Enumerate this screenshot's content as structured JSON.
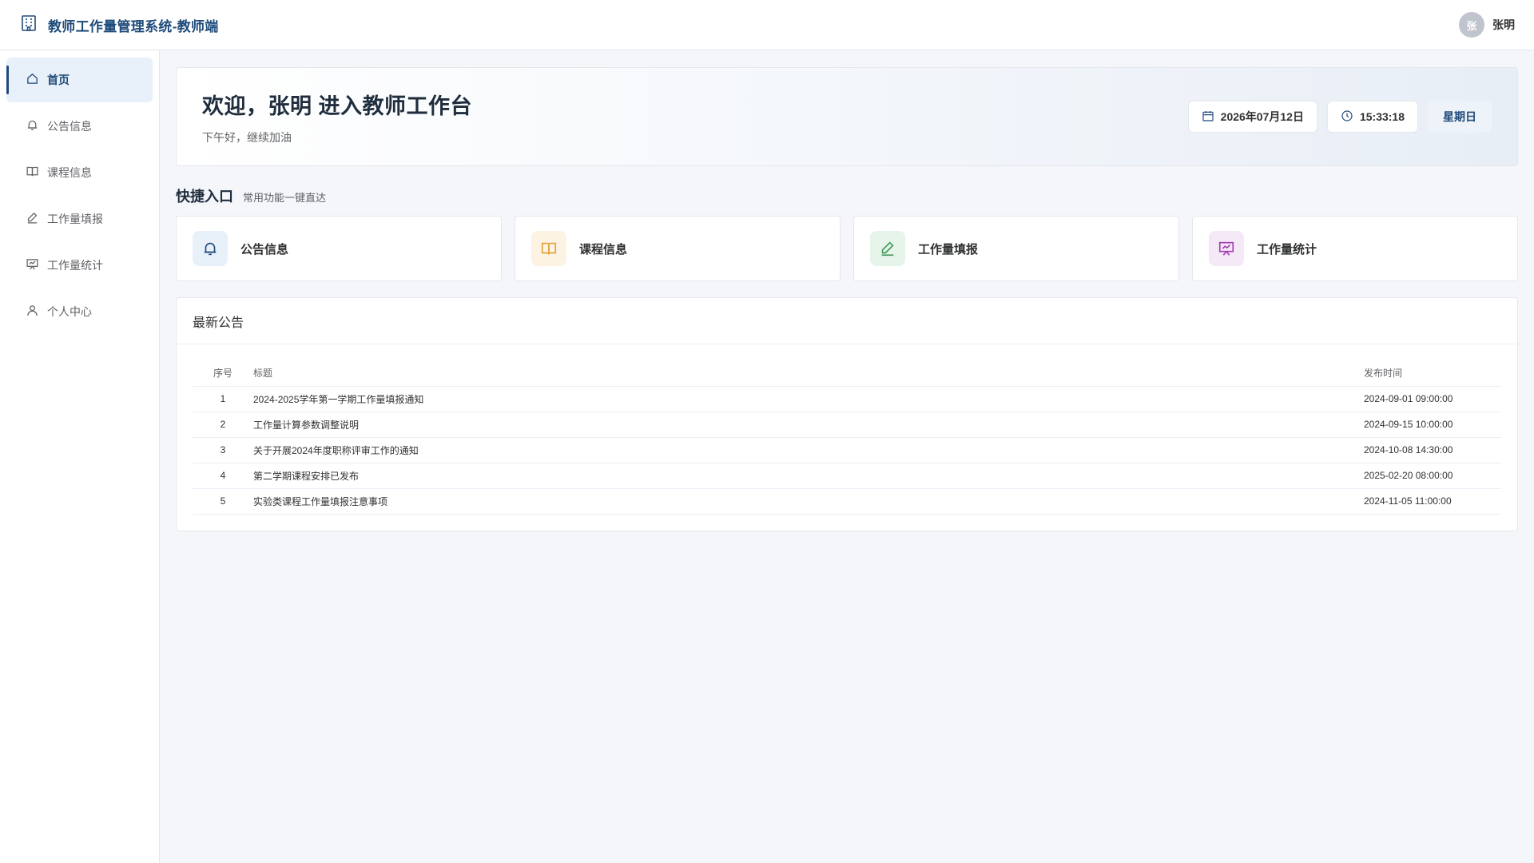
{
  "header": {
    "title": "教师工作量管理系统-教师端",
    "avatar_text": "张",
    "user_name": "张明"
  },
  "sidebar": {
    "items": [
      {
        "label": "首页",
        "icon": "home-icon",
        "active": true
      },
      {
        "label": "公告信息",
        "icon": "bell-icon"
      },
      {
        "label": "课程信息",
        "icon": "book-icon"
      },
      {
        "label": "工作量填报",
        "icon": "edit-pen-icon"
      },
      {
        "label": "工作量统计",
        "icon": "presentation-chart-icon"
      },
      {
        "label": "个人中心",
        "icon": "user-icon"
      }
    ]
  },
  "welcome": {
    "title": "欢迎，张明 进入教师工作台",
    "subtitle": "下午好，继续加油",
    "date": "2026年07月12日",
    "time": "15:33:18",
    "weekday": "星期日"
  },
  "quick": {
    "title": "快捷入口",
    "subtitle": "常用功能一键直达",
    "items": [
      {
        "label": "公告信息",
        "icon": "bell-icon",
        "color": "#1f4b7a",
        "bg": "#e8f0f9"
      },
      {
        "label": "课程信息",
        "icon": "book-icon",
        "color": "#e6a23c",
        "bg": "#fdf3e3"
      },
      {
        "label": "工作量填报",
        "icon": "edit-pen-icon",
        "color": "#3f9a5a",
        "bg": "#e6f4ea"
      },
      {
        "label": "工作量统计",
        "icon": "presentation-chart-icon",
        "color": "#a23fb0",
        "bg": "#f5e8f7"
      }
    ]
  },
  "notices": {
    "title": "最新公告",
    "columns": {
      "index": "序号",
      "title": "标题",
      "time": "发布时间"
    },
    "rows": [
      {
        "index": "1",
        "title": "2024-2025学年第一学期工作量填报通知",
        "time": "2024-09-01 09:00:00"
      },
      {
        "index": "2",
        "title": "工作量计算参数调整说明",
        "time": "2024-09-15 10:00:00"
      },
      {
        "index": "3",
        "title": "关于开展2024年度职称评审工作的通知",
        "time": "2024-10-08 14:30:00"
      },
      {
        "index": "4",
        "title": "第二学期课程安排已发布",
        "time": "2025-02-20 08:00:00"
      },
      {
        "index": "5",
        "title": "实验类课程工作量填报注意事项",
        "time": "2024-11-05 11:00:00"
      }
    ]
  }
}
